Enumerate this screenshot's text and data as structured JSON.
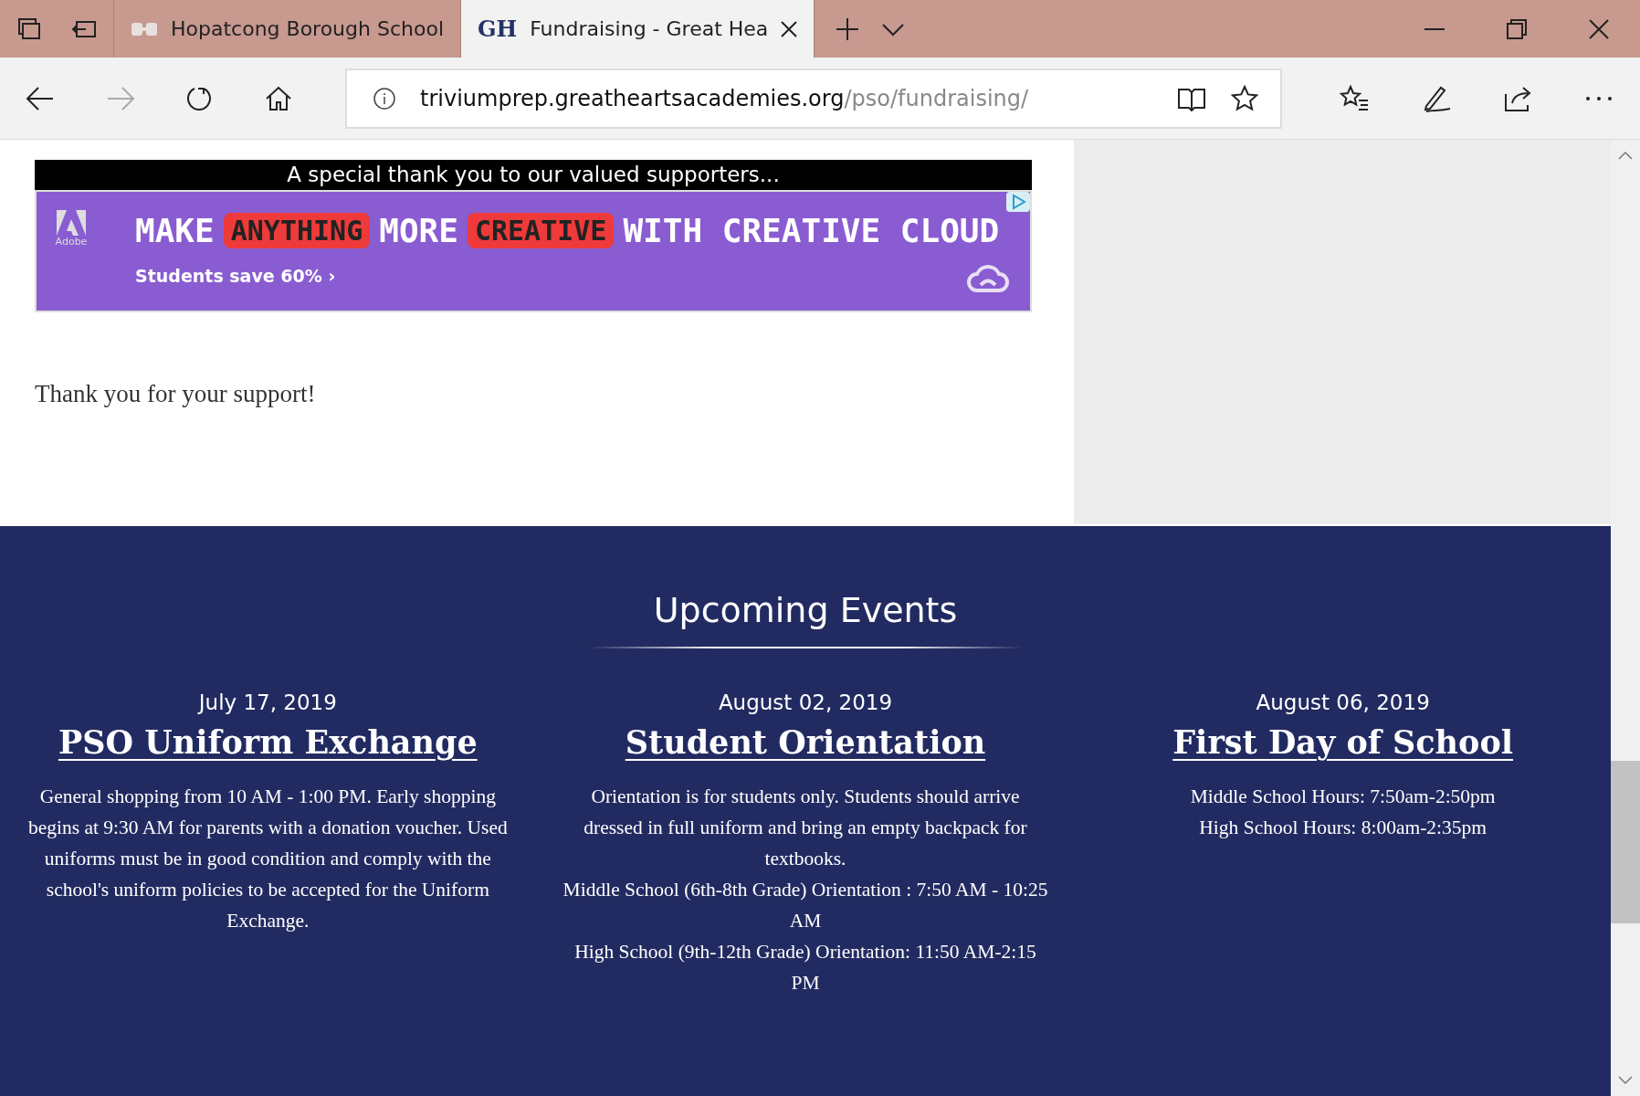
{
  "tabs": [
    {
      "title": "Hopatcong Borough School",
      "selected": false
    },
    {
      "title": "Fundraising - Great Hea",
      "selected": true,
      "favicon": "GH"
    }
  ],
  "address_bar": {
    "host": "triviumprep.greatheartsacademies.org",
    "path": "/pso/fundraising/"
  },
  "navigation": {
    "forward_disabled": true
  },
  "sponsors": {
    "heading": "A special thank you to our valued supporters...",
    "ad": {
      "brand": "Adobe",
      "words": [
        {
          "text": "MAKE",
          "kind": "plain"
        },
        {
          "text": "ANYTHING",
          "kind": "highlight"
        },
        {
          "text": "MORE",
          "kind": "plain"
        },
        {
          "text": "CREATIVE",
          "kind": "highlight"
        },
        {
          "text": "WITH CREATIVE CLOUD",
          "kind": "plain"
        }
      ],
      "offer": "Students save 60% ›"
    }
  },
  "thanks": "Thank you for your support!",
  "events": {
    "title": "Upcoming Events",
    "items": [
      {
        "date": "July 17, 2019",
        "name": "PSO Uniform Exchange",
        "description": [
          "General shopping from 10 AM - 1:00 PM. Early shopping begins at 9:30 AM for parents with a donation voucher. Used uniforms must be in good condition and comply with the school's uniform policies to be accepted for the Uniform Exchange."
        ]
      },
      {
        "date": "August 02, 2019",
        "name": "Student Orientation",
        "description": [
          "Orientation is for students only. Students should arrive dressed in full uniform and bring an empty backpack for textbooks.",
          "Middle School (6th-8th Grade) Orientation : 7:50 AM - 10:25 AM",
          "High School (9th-12th Grade) Orientation: 11:50 AM-2:15 PM"
        ]
      },
      {
        "date": "August 06, 2019",
        "name": "First Day of School",
        "description": [
          "Middle School Hours: 7:50am-2:50pm",
          "High School Hours: 8:00am-2:35pm"
        ]
      }
    ]
  }
}
